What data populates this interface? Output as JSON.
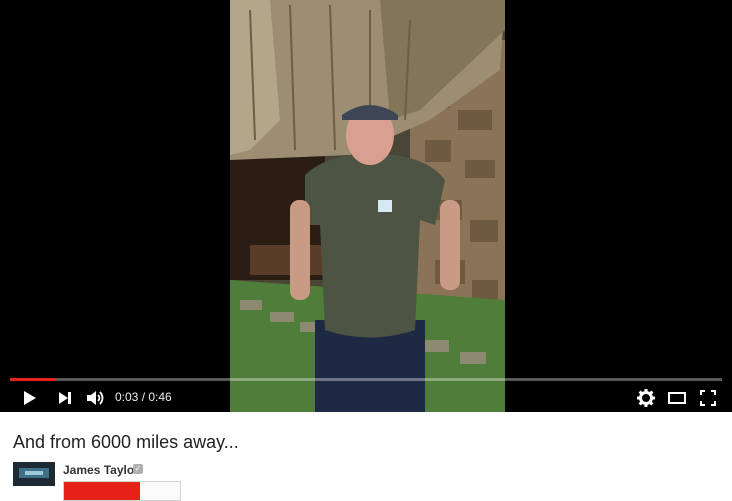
{
  "player": {
    "progress_played": 0.065,
    "controls": {
      "time_current": "0:03",
      "time_separator": " / ",
      "time_total": "0:46"
    }
  },
  "video": {
    "title": "And from 6000 miles away..."
  },
  "channel": {
    "name": "James Taylor",
    "verified_icon": "check"
  },
  "colors": {
    "accent": "#e62117",
    "player_bg": "#000000"
  }
}
